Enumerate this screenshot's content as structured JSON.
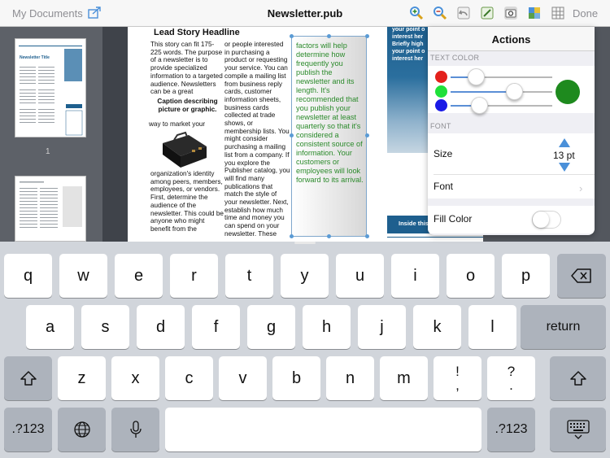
{
  "toolbar": {
    "back_label": "My Documents",
    "title": "Newsletter.pub",
    "done_label": "Done",
    "icons": [
      "share-icon",
      "zoom-in-icon",
      "zoom-out-icon",
      "undo-icon",
      "edit-icon",
      "camera-icon",
      "layers-icon",
      "grid-icon"
    ]
  },
  "thumbnails": {
    "page_number": "1",
    "thumb1_title": "Newsletter Title"
  },
  "document": {
    "headline": "Lead Story Headline",
    "col1_text": "This story can fit 175-225 words. The purpose of a newsletter is to provide specialized information to a targeted audience. Newsletters can be a great",
    "caption": "Caption describing picture or graphic.",
    "col1_fragment": "way to market your",
    "col1_text2": "organization's identity among peers, members, employees, or vendors. First, determine the audience of the newsletter. This could be anyone who might benefit from the",
    "col2_text": "or people interested in purchasing a product or requesting your service. You can compile a mailing list from business reply cards, customer information sheets, business cards collected at trade shows, or membership lists. You might consider purchasing a mailing list from a company. If you explore the Publisher catalog, you will find many publications that match the style of your newsletter. Next, establish how much time and money you can spend on your newsletter. These",
    "textbox_text": "factors will help determine how frequently you publish the newsletter and its length. It's recommended that you publish your newsletter at least quarterly so that it's considered a consistent source of information. Your customers or employees will look forward to its arrival.",
    "side_line1": "your point o",
    "side_line2": "interest her",
    "side_line3": "Briefly high",
    "side_line4": "your point o",
    "side_line5": "interest her",
    "inside_label": "Inside this"
  },
  "actions": {
    "title": "Actions",
    "text_color_label": "TEXT COLOR",
    "red_level": 0.25,
    "green_level": 0.62,
    "blue_level": 0.28,
    "selected_color": "#1e8a1e",
    "font_label": "FONT",
    "size_label": "Size",
    "size_value": "13 pt",
    "font_row_label": "Font",
    "fill_color_label": "Fill Color",
    "fill_color_on": false
  },
  "keyboard": {
    "row1": [
      "q",
      "w",
      "e",
      "r",
      "t",
      "y",
      "u",
      "i",
      "o",
      "p"
    ],
    "row2": [
      "a",
      "s",
      "d",
      "f",
      "g",
      "h",
      "j",
      "k",
      "l"
    ],
    "return_label": "return",
    "row3": [
      "z",
      "x",
      "c",
      "v",
      "b",
      "n",
      "m"
    ],
    "punct1_top": "!",
    "punct1_bottom": ",",
    "punct2_top": "?",
    "punct2_bottom": ".",
    "numbers_label": ".?123"
  }
}
